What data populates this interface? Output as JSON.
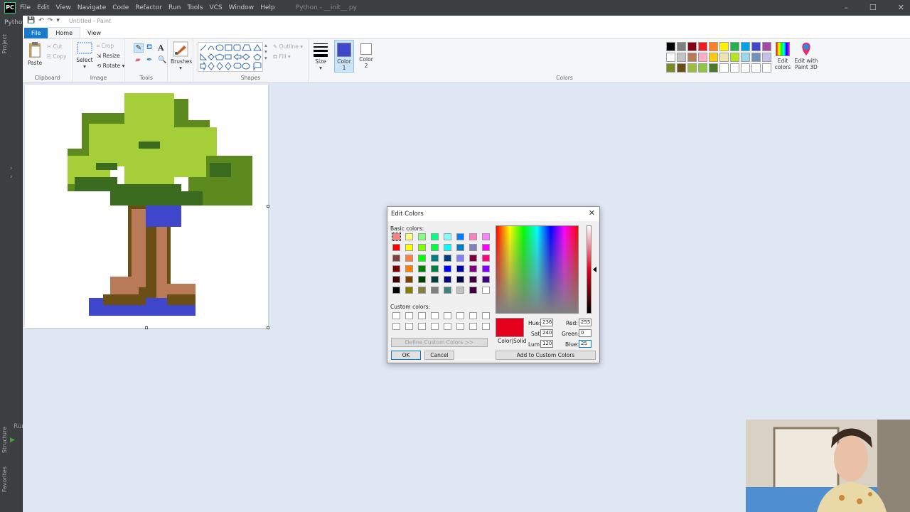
{
  "ide": {
    "menu": [
      "File",
      "Edit",
      "View",
      "Navigate",
      "Code",
      "Refactor",
      "Run",
      "Tools",
      "VCS",
      "Window",
      "Help"
    ],
    "title": "Python - __init__.py",
    "project_label": "Pytho",
    "side_project": "Project",
    "side_structure": "Structure",
    "side_favorites": "Favorites",
    "side_run": "Run"
  },
  "paint": {
    "window_title": "Untitled - Paint",
    "tabs": {
      "file": "File",
      "home": "Home",
      "view": "View"
    },
    "clipboard": {
      "paste": "Paste",
      "cut": "Cut",
      "copy": "Copy",
      "label": "Clipboard"
    },
    "image": {
      "select": "Select",
      "crop": "Crop",
      "resize": "Resize",
      "rotate": "Rotate",
      "label": "Image"
    },
    "tools": {
      "label": "Tools"
    },
    "brushes": {
      "label": "Brushes"
    },
    "shapes": {
      "outline": "Outline",
      "fill": "Fill",
      "label": "Shapes"
    },
    "size": {
      "label": "Size"
    },
    "color1": {
      "label": "Color 1",
      "color": "#3f48cc"
    },
    "color2": {
      "label": "Color 2",
      "color": "#ffffff"
    },
    "colors": {
      "label": "Colors"
    },
    "edit_colors": "Edit colors",
    "edit_3d": "Edit with Paint 3D",
    "palette": [
      "#000000",
      "#7f7f7f",
      "#880015",
      "#ed1c24",
      "#ff7f27",
      "#fff200",
      "#22b14c",
      "#00a2e8",
      "#3f48cc",
      "#a349a4",
      "#ffffff",
      "#c3c3c3",
      "#b97a57",
      "#ffaec9",
      "#ffc90e",
      "#efe4b0",
      "#b5e61d",
      "#99d9ea",
      "#7092be",
      "#c8bfe7",
      "#7a8c21",
      "#6b4e16",
      "#9bbf3c",
      "#8dc63f",
      "#4d7a24",
      "#ffffff",
      "#ffffff",
      "#ffffff",
      "#ffffff",
      "#ffffff"
    ]
  },
  "dialog": {
    "title": "Edit Colors",
    "basic_colors_label": "Basic colors:",
    "custom_colors_label": "Custom colors:",
    "define_custom": "Define Custom Colors >>",
    "ok": "OK",
    "cancel": "Cancel",
    "color_solid": "Color|Solid",
    "add_custom": "Add to Custom Colors",
    "hue_label": "Hue:",
    "hue": "236",
    "sat_label": "Sat:",
    "sat": "240",
    "lum_label": "Lum:",
    "lum": "120",
    "red_label": "Red:",
    "red": "255",
    "green_label": "Green:",
    "green": "0",
    "blue_label": "Blue:",
    "blue": "25",
    "basic_colors": [
      "#ff8080",
      "#ffff80",
      "#80ff80",
      "#00ff80",
      "#80ffff",
      "#0080ff",
      "#ff80c0",
      "#ff80ff",
      "#ff0000",
      "#ffff00",
      "#80ff00",
      "#00ff40",
      "#00ffff",
      "#0080c0",
      "#8080c0",
      "#ff00ff",
      "#804040",
      "#ff8040",
      "#00ff00",
      "#008080",
      "#004080",
      "#8080ff",
      "#800040",
      "#ff0080",
      "#800000",
      "#ff8000",
      "#008000",
      "#008040",
      "#0000ff",
      "#0000a0",
      "#800080",
      "#8000ff",
      "#400000",
      "#804000",
      "#004000",
      "#004040",
      "#000080",
      "#000040",
      "#400040",
      "#400080",
      "#000000",
      "#808000",
      "#808040",
      "#808080",
      "#408080",
      "#c0c0c0",
      "#400040",
      "#ffffff"
    ]
  }
}
